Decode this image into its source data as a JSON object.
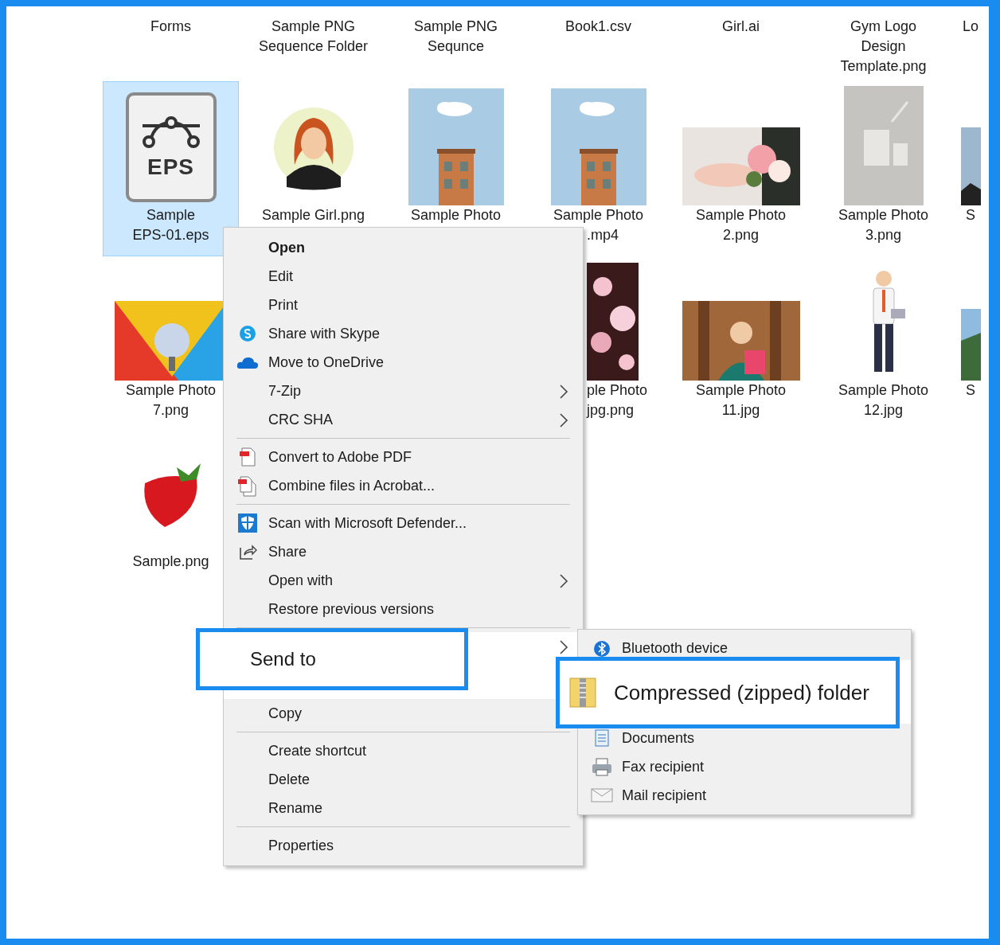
{
  "rows": [
    {
      "tiles": [
        {
          "kind": "label",
          "selected": false,
          "lines": [
            {
              "text": "Forms"
            }
          ]
        },
        {
          "kind": "label",
          "selected": false,
          "lines": [
            {
              "text": "Sample PNG"
            },
            {
              "text": "Sequence Folder"
            }
          ]
        },
        {
          "kind": "label",
          "selected": false,
          "lines": [
            {
              "text": "Sample PNG"
            },
            {
              "text": "Sequnce"
            }
          ]
        },
        {
          "kind": "label",
          "selected": false,
          "lines": [
            {
              "text": "Book1.csv"
            }
          ]
        },
        {
          "kind": "label",
          "selected": false,
          "lines": [
            {
              "text": "Girl.ai"
            }
          ]
        },
        {
          "kind": "label",
          "selected": false,
          "lines": [
            {
              "text": "Gym Logo"
            },
            {
              "text": "Design"
            },
            {
              "text": "Template.png"
            }
          ]
        },
        {
          "kind": "label",
          "selected": false,
          "lines": [
            {
              "text": "Lo"
            }
          ]
        }
      ]
    },
    {
      "tiles": [
        {
          "kind": "file-icon",
          "selected": true,
          "badge": "EPS",
          "lines": [
            {
              "text": "Sample"
            },
            {
              "text": "EPS-01.eps"
            }
          ]
        },
        {
          "kind": "picture",
          "selected": false,
          "lines": [
            {
              "text": "Sample Girl.png"
            }
          ]
        },
        {
          "kind": "picture",
          "selected": false,
          "lines": [
            {
              "text": "Sample Photo"
            }
          ]
        },
        {
          "kind": "picture",
          "selected": false,
          "lines": [
            {
              "text": "Sample Photo"
            },
            {
              "text": ".mp4",
              "cut": true
            }
          ]
        },
        {
          "kind": "picture",
          "selected": false,
          "lines": [
            {
              "text": "Sample Photo"
            },
            {
              "text": "2.png"
            }
          ]
        },
        {
          "kind": "picture",
          "selected": false,
          "lines": [
            {
              "text": "Sample Photo"
            },
            {
              "text": "3.png"
            }
          ]
        },
        {
          "kind": "picture",
          "selected": false,
          "lines": [
            {
              "text": "S"
            }
          ]
        }
      ]
    },
    {
      "tiles": [
        {
          "kind": "picture",
          "selected": false,
          "lines": [
            {
              "text": "Sample Photo"
            },
            {
              "text": "7.png"
            }
          ]
        },
        {
          "kind": "picture",
          "selected": false,
          "cut": true,
          "lines": [
            {
              "text": "ple Photo",
              "cut": true
            },
            {
              "text": "jpg.png",
              "cut": true
            }
          ]
        },
        {
          "kind": "picture",
          "selected": false,
          "lines": [
            {
              "text": "Sample Photo"
            },
            {
              "text": "11.jpg"
            }
          ]
        },
        {
          "kind": "picture",
          "selected": false,
          "lines": [
            {
              "text": "Sample Photo"
            },
            {
              "text": "12.jpg"
            }
          ]
        },
        {
          "kind": "picture",
          "selected": false,
          "lines": [
            {
              "text": "S"
            }
          ]
        }
      ]
    },
    {
      "tiles": [
        {
          "kind": "picture",
          "selected": false,
          "lines": [
            {
              "text": "Sample.png"
            }
          ]
        }
      ]
    }
  ],
  "context_menu": {
    "items": [
      {
        "kind": "item",
        "label": "Open",
        "default": true,
        "submenu": false,
        "selected": false
      },
      {
        "kind": "item",
        "label": "Edit",
        "default": false,
        "submenu": false,
        "selected": false
      },
      {
        "kind": "item",
        "label": "Print",
        "default": false,
        "submenu": false,
        "selected": false
      },
      {
        "kind": "item",
        "label": "Share with Skype",
        "default": false,
        "submenu": false,
        "selected": false
      },
      {
        "kind": "item",
        "label": "Move to OneDrive",
        "default": false,
        "submenu": false,
        "selected": false
      },
      {
        "kind": "item",
        "label": "7-Zip",
        "default": false,
        "submenu": true,
        "selected": false
      },
      {
        "kind": "item",
        "label": "CRC SHA",
        "default": false,
        "submenu": true,
        "selected": false
      },
      {
        "kind": "separator"
      },
      {
        "kind": "item",
        "label": "Convert to Adobe PDF",
        "default": false,
        "submenu": false,
        "selected": false
      },
      {
        "kind": "item",
        "label": "Combine files in Acrobat...",
        "default": false,
        "submenu": false,
        "selected": false
      },
      {
        "kind": "separator"
      },
      {
        "kind": "item",
        "label": "Scan with Microsoft Defender...",
        "default": false,
        "submenu": false,
        "selected": false
      },
      {
        "kind": "item",
        "label": "Share",
        "default": false,
        "submenu": false,
        "selected": false
      },
      {
        "kind": "item",
        "label": "Open with",
        "default": false,
        "submenu": true,
        "selected": false
      },
      {
        "kind": "item",
        "label": "Restore previous versions",
        "default": false,
        "submenu": false,
        "selected": false
      },
      {
        "kind": "separator"
      },
      {
        "kind": "callout",
        "label": "Send to",
        "default": false,
        "submenu": true,
        "selected": true
      },
      {
        "kind": "item",
        "label": "Copy",
        "default": false,
        "submenu": false,
        "selected": false
      },
      {
        "kind": "separator"
      },
      {
        "kind": "item",
        "label": "Create shortcut",
        "default": false,
        "submenu": false,
        "selected": false
      },
      {
        "kind": "item",
        "label": "Delete",
        "default": false,
        "submenu": false,
        "selected": false
      },
      {
        "kind": "item",
        "label": "Rename",
        "default": false,
        "submenu": false,
        "selected": false
      },
      {
        "kind": "separator"
      },
      {
        "kind": "item",
        "label": "Properties",
        "default": false,
        "submenu": false,
        "selected": false
      }
    ]
  },
  "send_to_menu": {
    "items": [
      {
        "kind": "top",
        "label": "Bluetooth device",
        "selected": false
      },
      {
        "kind": "callout",
        "label": "Compressed (zipped) folder",
        "selected": true
      },
      {
        "kind": "item",
        "label": "Documents",
        "selected": false
      },
      {
        "kind": "item",
        "label": "Fax recipient",
        "selected": false
      },
      {
        "kind": "item",
        "label": "Mail recipient",
        "selected": false
      }
    ]
  }
}
